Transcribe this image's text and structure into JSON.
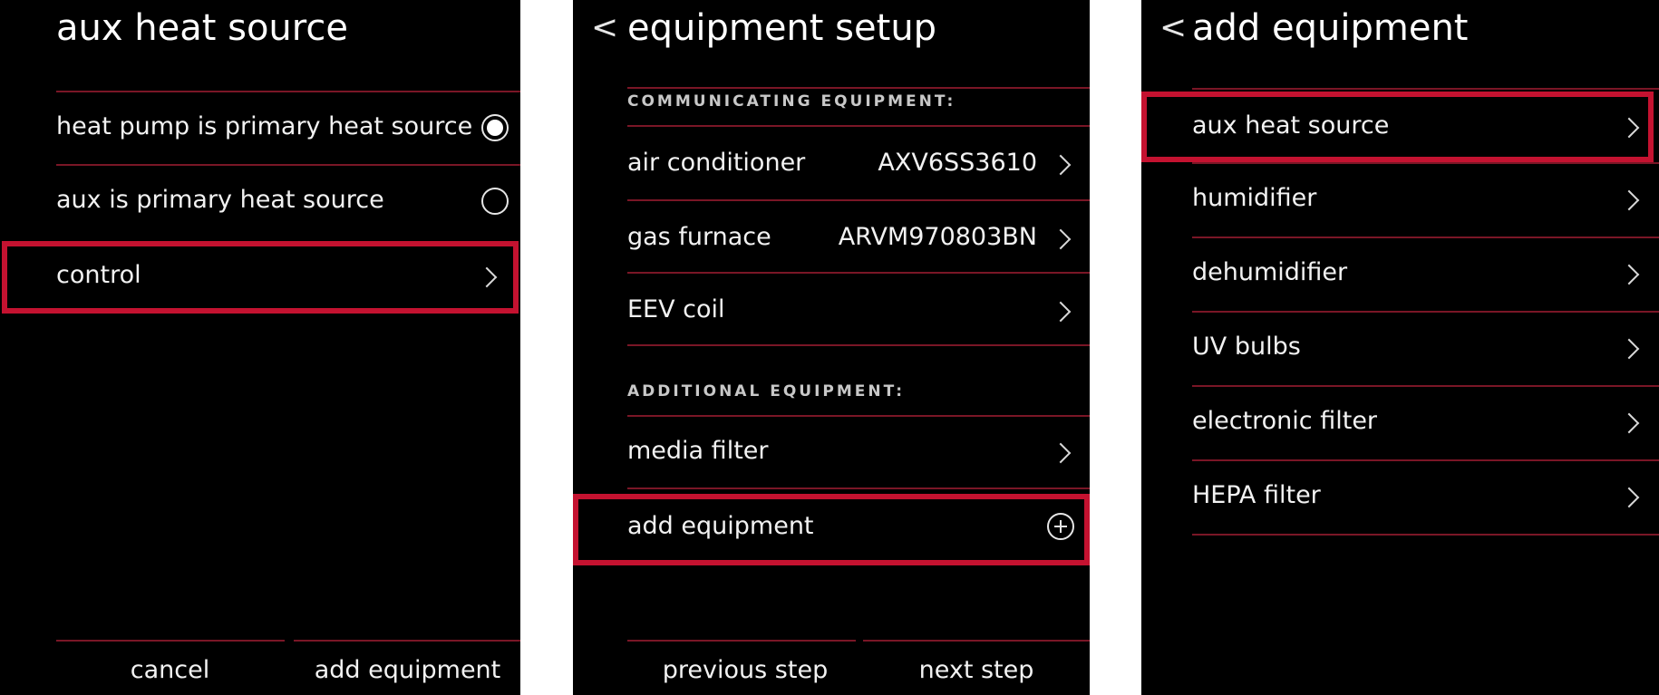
{
  "screen1": {
    "title": "aux heat source",
    "option1": "heat pump is primary heat source",
    "option2": "aux is primary heat source",
    "control": "control",
    "cancel": "cancel",
    "add_equipment": "add equipment"
  },
  "screen2": {
    "back": "<",
    "title": "equipment setup",
    "section1": "COMMUNICATING EQUIPMENT:",
    "air_conditioner": "air conditioner",
    "air_conditioner_model": "AXV6SS3610",
    "gas_furnace": "gas furnace",
    "gas_furnace_model": "ARVM970803BN",
    "eev_coil": "EEV coil",
    "section2": "ADDITIONAL EQUIPMENT:",
    "media_filter": "media filter",
    "add_equipment": "add equipment",
    "previous_step": "previous step",
    "next_step": "next step"
  },
  "screen3": {
    "back": "<",
    "title": "add equipment",
    "items": [
      "aux heat source",
      "humidifier",
      "dehumidifier",
      "UV bulbs",
      "electronic filter",
      "HEPA filter"
    ]
  },
  "colors": {
    "highlight": "#c41230",
    "divider": "#7a1626",
    "background": "#000000"
  }
}
